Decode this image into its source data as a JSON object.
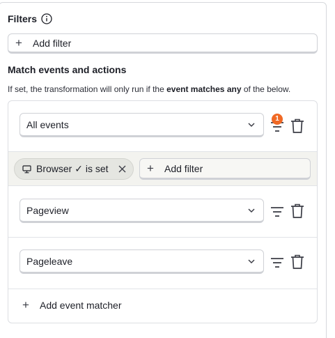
{
  "filters": {
    "title": "Filters",
    "add_filter_label": "Add filter"
  },
  "match": {
    "title": "Match events and actions",
    "description_prefix": "If set, the transformation will only run if the ",
    "description_bold": "event matches any",
    "description_suffix": " of the below.",
    "matchers": [
      {
        "selected": "All events",
        "filter_count": "1"
      },
      {
        "selected": "Pageview"
      },
      {
        "selected": "Pageleave"
      }
    ],
    "property_filter": {
      "chip_label": "Browser ✓ is set",
      "add_filter_label": "Add filter"
    },
    "add_matcher_label": "Add event matcher"
  },
  "colors": {
    "badge": "#f06925",
    "filter_bar_bg": "#f3f3ef",
    "border": "#cfd1d6"
  },
  "icons": [
    "info-icon",
    "plus-icon",
    "chevron-down-icon",
    "filter-icon",
    "trash-icon",
    "monitor-icon",
    "close-icon"
  ]
}
